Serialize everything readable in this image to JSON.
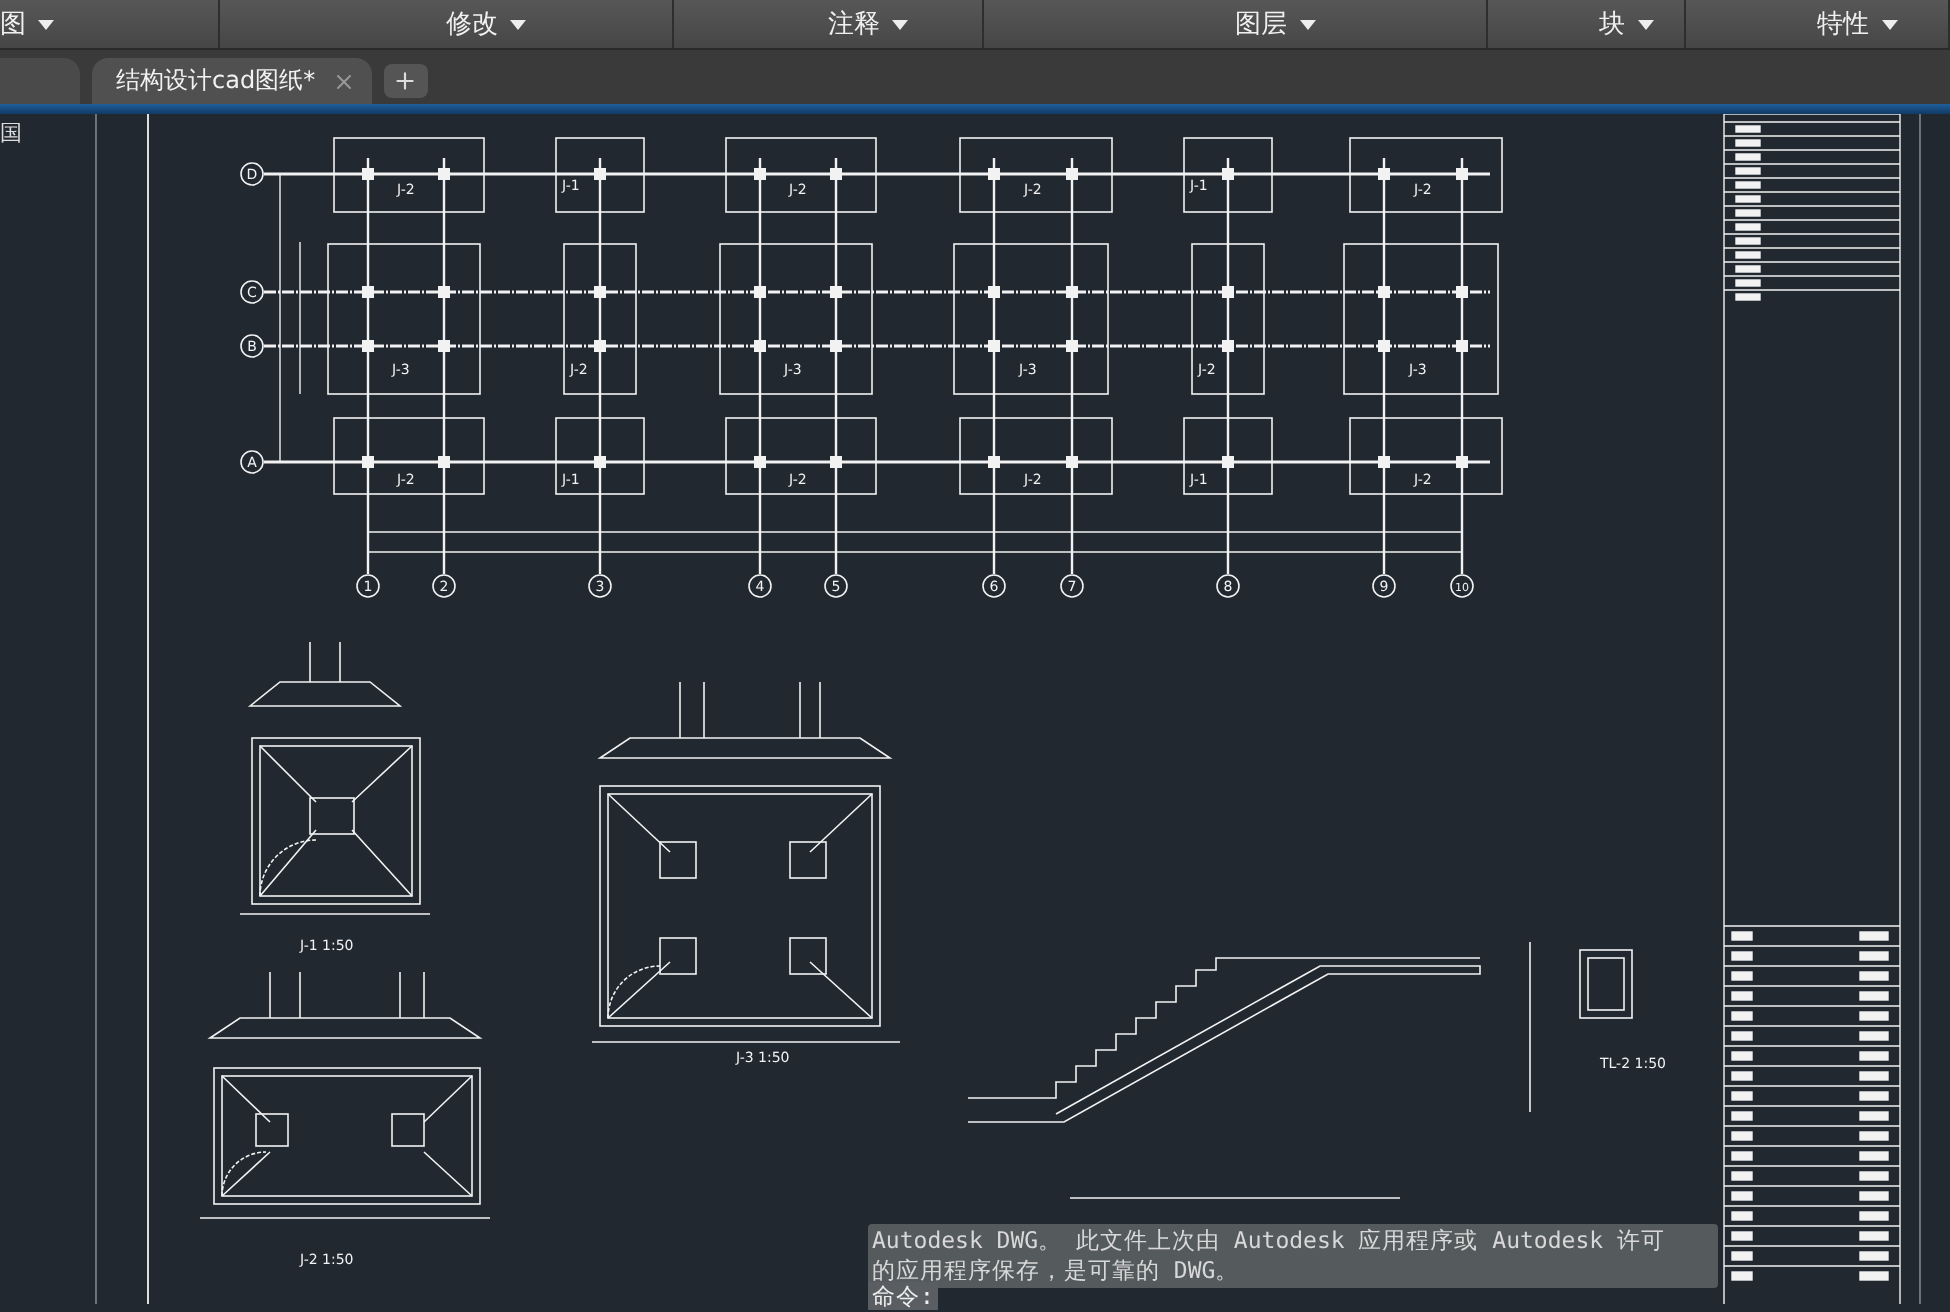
{
  "ribbon": {
    "panels": [
      {
        "label": "图"
      },
      {
        "label": "修改"
      },
      {
        "label": "注释"
      },
      {
        "label": "图层"
      },
      {
        "label": "块"
      },
      {
        "label": "特性"
      }
    ]
  },
  "file_tabs": [
    {
      "label": "结构设计cad图纸*",
      "selected": true
    }
  ],
  "viewport_label": "国",
  "plan": {
    "row_axes": [
      "D",
      "C",
      "B",
      "A"
    ],
    "column_axes": [
      "1",
      "2",
      "3",
      "4",
      "5",
      "6",
      "7",
      "8",
      "9",
      "10"
    ],
    "footing_rows": [
      {
        "labels": [
          "J-2",
          "J-1",
          "J-2",
          "J-2",
          "J-1",
          "J-2"
        ]
      },
      {
        "labels": [
          "J-3",
          "J-2",
          "J-3",
          "J-3",
          "J-2",
          "J-3"
        ]
      },
      {
        "labels": [
          "J-2",
          "J-1",
          "J-2",
          "J-2",
          "J-1",
          "J-2"
        ]
      }
    ]
  },
  "details": [
    {
      "kind": "square",
      "caption": "J-1 1:50"
    },
    {
      "kind": "wide",
      "caption": "J-2 1:50"
    },
    {
      "kind": "large",
      "caption": "J-3 1:50"
    },
    {
      "kind": "beam",
      "caption": "TL-2 1:50"
    }
  ],
  "command_line": {
    "history": [
      "Autodesk DWG。  此文件上次由 Autodesk 应用程序或 Autodesk 许可",
      "的应用程序保存，是可靠的 DWG。"
    ],
    "prompt": "命令:"
  }
}
